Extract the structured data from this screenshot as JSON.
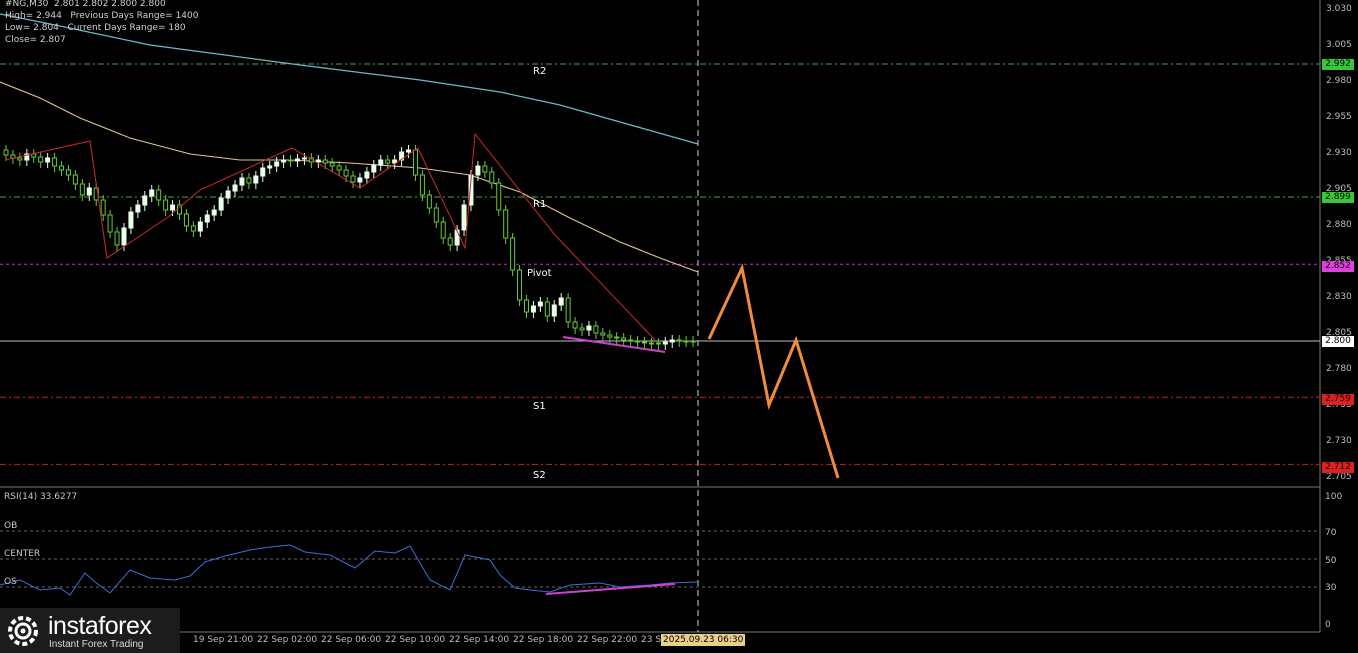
{
  "header": {
    "symbol_line": "#NG,M30  2.801 2.802 2.800 2.800",
    "high_line": "High= 2.944   Previous Days Range= 1400",
    "low_line": "Low= 2.804   Current Days Range= 180",
    "close_line": "Close= 2.807"
  },
  "levels": {
    "r2": {
      "label": "R2",
      "price": "2.992"
    },
    "r1": {
      "label": "R1",
      "price": "2.899"
    },
    "pivot": {
      "label": "Pivot",
      "price": "2.852"
    },
    "current": {
      "price": "2.800"
    },
    "s1": {
      "label": "S1",
      "price": "2.759"
    },
    "s2": {
      "label": "S2",
      "price": "2.712"
    }
  },
  "price_axis": [
    "3.030",
    "3.005",
    "2.980",
    "2.955",
    "2.930",
    "2.905",
    "2.880",
    "2.855",
    "2.830",
    "2.805",
    "2.780",
    "2.755",
    "2.730",
    "2.705"
  ],
  "rsi": {
    "title": "RSI(14) 33.6277",
    "ob_label": "OB",
    "center_label": "CENTER",
    "os_label": "OS",
    "axis": [
      "100",
      "70",
      "50",
      "30",
      "0"
    ]
  },
  "time_axis": [
    "19 Sep 21:00",
    "22 Sep 02:00",
    "22 Sep 06:00",
    "22 Sep 10:00",
    "22 Sep 14:00",
    "22 Sep 18:00",
    "22 Sep 22:00",
    "23 S"
  ],
  "time_cursor": "2025.09.23 06:30",
  "logo": {
    "name": "instaforex",
    "tagline": "Instant Forex Trading"
  },
  "colors": {
    "bull_candle": "#e8ffe8",
    "bear_candle": "#66cc33",
    "level_green": "#4caf50",
    "pivot_magenta": "#cc33cc",
    "support_red": "#cc2222",
    "forecast": "#f08c3c",
    "ma_slow": "#6fb8c8",
    "ma_fast": "#e0c890",
    "rsi_line": "#3a6fd8"
  }
}
